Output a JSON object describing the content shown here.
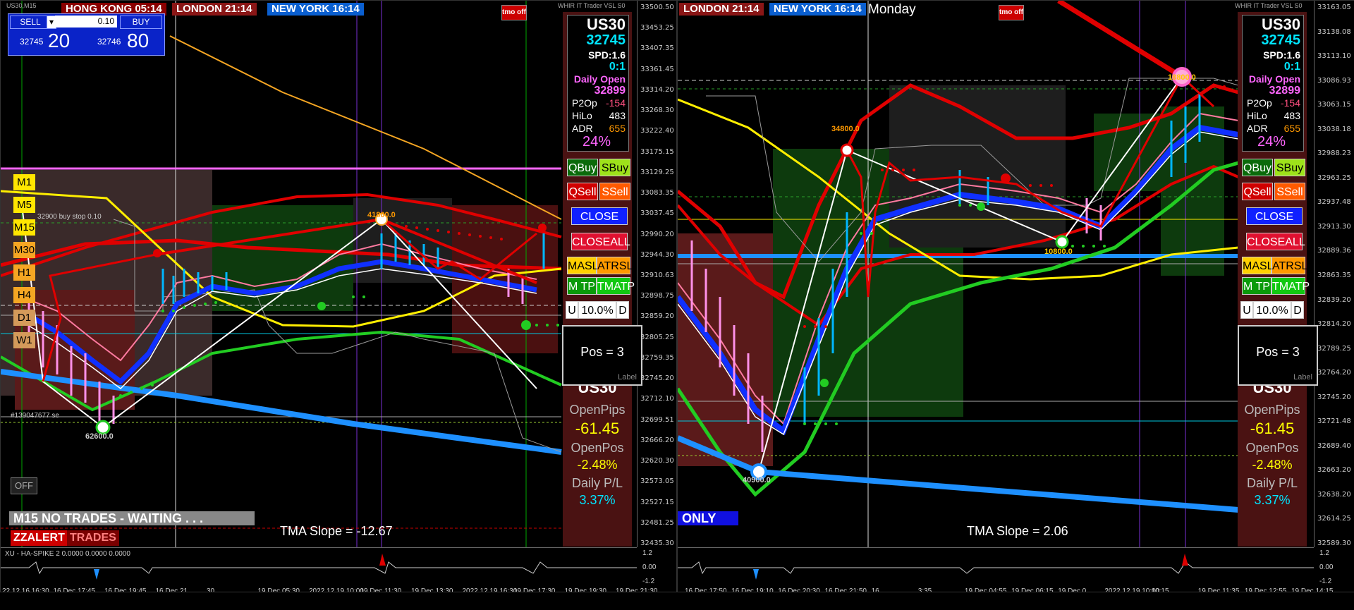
{
  "left_chart": {
    "symbol_caption": "US30,M15",
    "timezones": [
      {
        "label": "HONG KONG 05:14"
      },
      {
        "label": "LONDON 21:14"
      },
      {
        "label": "NEW YORK 16:14"
      }
    ],
    "tmoff": "tmo off",
    "top_caption": "WHIR IT Trader VSL S0",
    "trade_box": {
      "sell": "SELL",
      "buy": "BUY",
      "lot": "0.10",
      "spin": "▾",
      "bid_small": "32745",
      "bid_big": "20",
      "ask_small": "32746",
      "ask_big": "80"
    },
    "timeframes": [
      {
        "label": "M1",
        "color": "#ffe600"
      },
      {
        "label": "M5",
        "color": "#ffe600"
      },
      {
        "label": "M15",
        "color": "#ffe600"
      },
      {
        "label": "M30",
        "color": "#f5a623"
      },
      {
        "label": "H1",
        "color": "#f5a623"
      },
      {
        "label": "H4",
        "color": "#f5a623"
      },
      {
        "label": "D1",
        "color": "#d49a5a"
      },
      {
        "label": "W1",
        "color": "#d49a5a"
      }
    ],
    "pending_order": "32900 buy stop 0.10",
    "zig_labels": [
      "41800.0",
      "62600.0"
    ],
    "ticket_note": "#139047677 se",
    "status": "M15  NO TRADES - WAITING . . .",
    "zzalert": "ZZALERT",
    "trades": "TRADES",
    "off": "OFF",
    "tma_slope": "TMA Slope = -12.67",
    "subwindow_title": "XU - HA-SPIKE 2 0.0000 0.0000 0.0000",
    "sub_axis": [
      "1.2",
      "0.00",
      "-1.2"
    ],
    "price_ticks": [
      "33500.50",
      "33453.25",
      "33407.35",
      "33361.45",
      "33314.20",
      "33268.30",
      "33222.40",
      "33175.15",
      "33129.25",
      "33083.35",
      "33037.45",
      "32990.20",
      "32944.30",
      "32910.63",
      "32898.75",
      "32859.20",
      "32805.25",
      "32759.35",
      "32745.20",
      "32712.10",
      "32699.51",
      "32666.20",
      "32620.30",
      "32573.05",
      "32527.15",
      "32481.25",
      "32435.30"
    ],
    "time_labels": [
      "22.12.16 16:30",
      "16 Dec 17:45",
      "16 Dec 19:45",
      "16 Dec 21",
      "30",
      "19 Dec 05:30",
      "2022.12.19 10:00",
      "19 Dec 11:30",
      "19 Dec 13:30",
      "2022.12.19 16:30",
      "19 Dec 17:30",
      "19 Dec 19:30",
      "19 Dec 21:30"
    ]
  },
  "right_chart": {
    "timezones": [
      {
        "label": "LONDON 21:14"
      },
      {
        "label": "NEW YORK 16:14"
      }
    ],
    "day": "Monday",
    "tmoff": "tmo off",
    "top_caption": "WHIR IT Trader VSL S0",
    "zig_labels": [
      "34800.0",
      "40900.0",
      "10800.0",
      "18800.0"
    ],
    "only": "ONLY",
    "tma_slope": "TMA Slope = 2.06",
    "sub_axis": [
      "1.2",
      "0.00",
      "-1.2"
    ],
    "price_ticks": [
      "33163.05",
      "33138.08",
      "33113.10",
      "33086.93",
      "33063.15",
      "33038.18",
      "32988.23",
      "32963.25",
      "32937.48",
      "32913.30",
      "32889.36",
      "32863.35",
      "32839.20",
      "32814.20",
      "32789.25",
      "32764.20",
      "32745.20",
      "32721.48",
      "32689.40",
      "32663.20",
      "32638.20",
      "32614.25",
      "32589.30"
    ],
    "time_labels": [
      "16 Dec 17:50",
      "16 Dec 19:10",
      "16 Dec 20:30",
      "16 Dec 21:50",
      "16",
      "3:35",
      "19 Dec 04:55",
      "19 Dec 06:15",
      "19 Dec 0",
      "2022.12.19 10:00",
      "10:15",
      "19 Dec 11:35",
      "19 Dec 12:55",
      "19 Dec 14:15"
    ]
  },
  "info_panel": {
    "symbol": "US30",
    "price": "32745",
    "spread": "SPD:1.6",
    "ratio": "0:1",
    "daily_open_label": "Daily Open",
    "daily_open": "32899",
    "p2op_label": "P2Op",
    "p2op": "-154",
    "hilo_label": "HiLo",
    "hilo": "483",
    "adr_label": "ADR",
    "adr": "655",
    "pct": "24%"
  },
  "buttons": {
    "qbuy": "QBuy",
    "sbuy": "SBuy",
    "qsell": "QSell",
    "ssell": "SSell",
    "close": "CLOSE",
    "closeall": "CLOSEALL",
    "masl": "MASL",
    "atrsl": "ATRSL",
    "mtp": "M TP",
    "tmatp": "TMATP",
    "u": "U",
    "risk": "10.0%",
    "d": "D"
  },
  "position": {
    "text": "Pos = 3",
    "label": "Label"
  },
  "stats": {
    "symbol": "US30",
    "openpips_label": "OpenPips",
    "openpips": "-61.45",
    "openpos_label": "OpenPos",
    "openpos": "-2.48%",
    "daily_label": "Daily P/L",
    "daily": "3.37%"
  },
  "colors": {
    "green": "#00cc00",
    "red": "#e00000",
    "blue": "#1030ff",
    "yellow": "#ffff00",
    "cyan": "#00e5ff",
    "magenta": "#ff66ff"
  }
}
